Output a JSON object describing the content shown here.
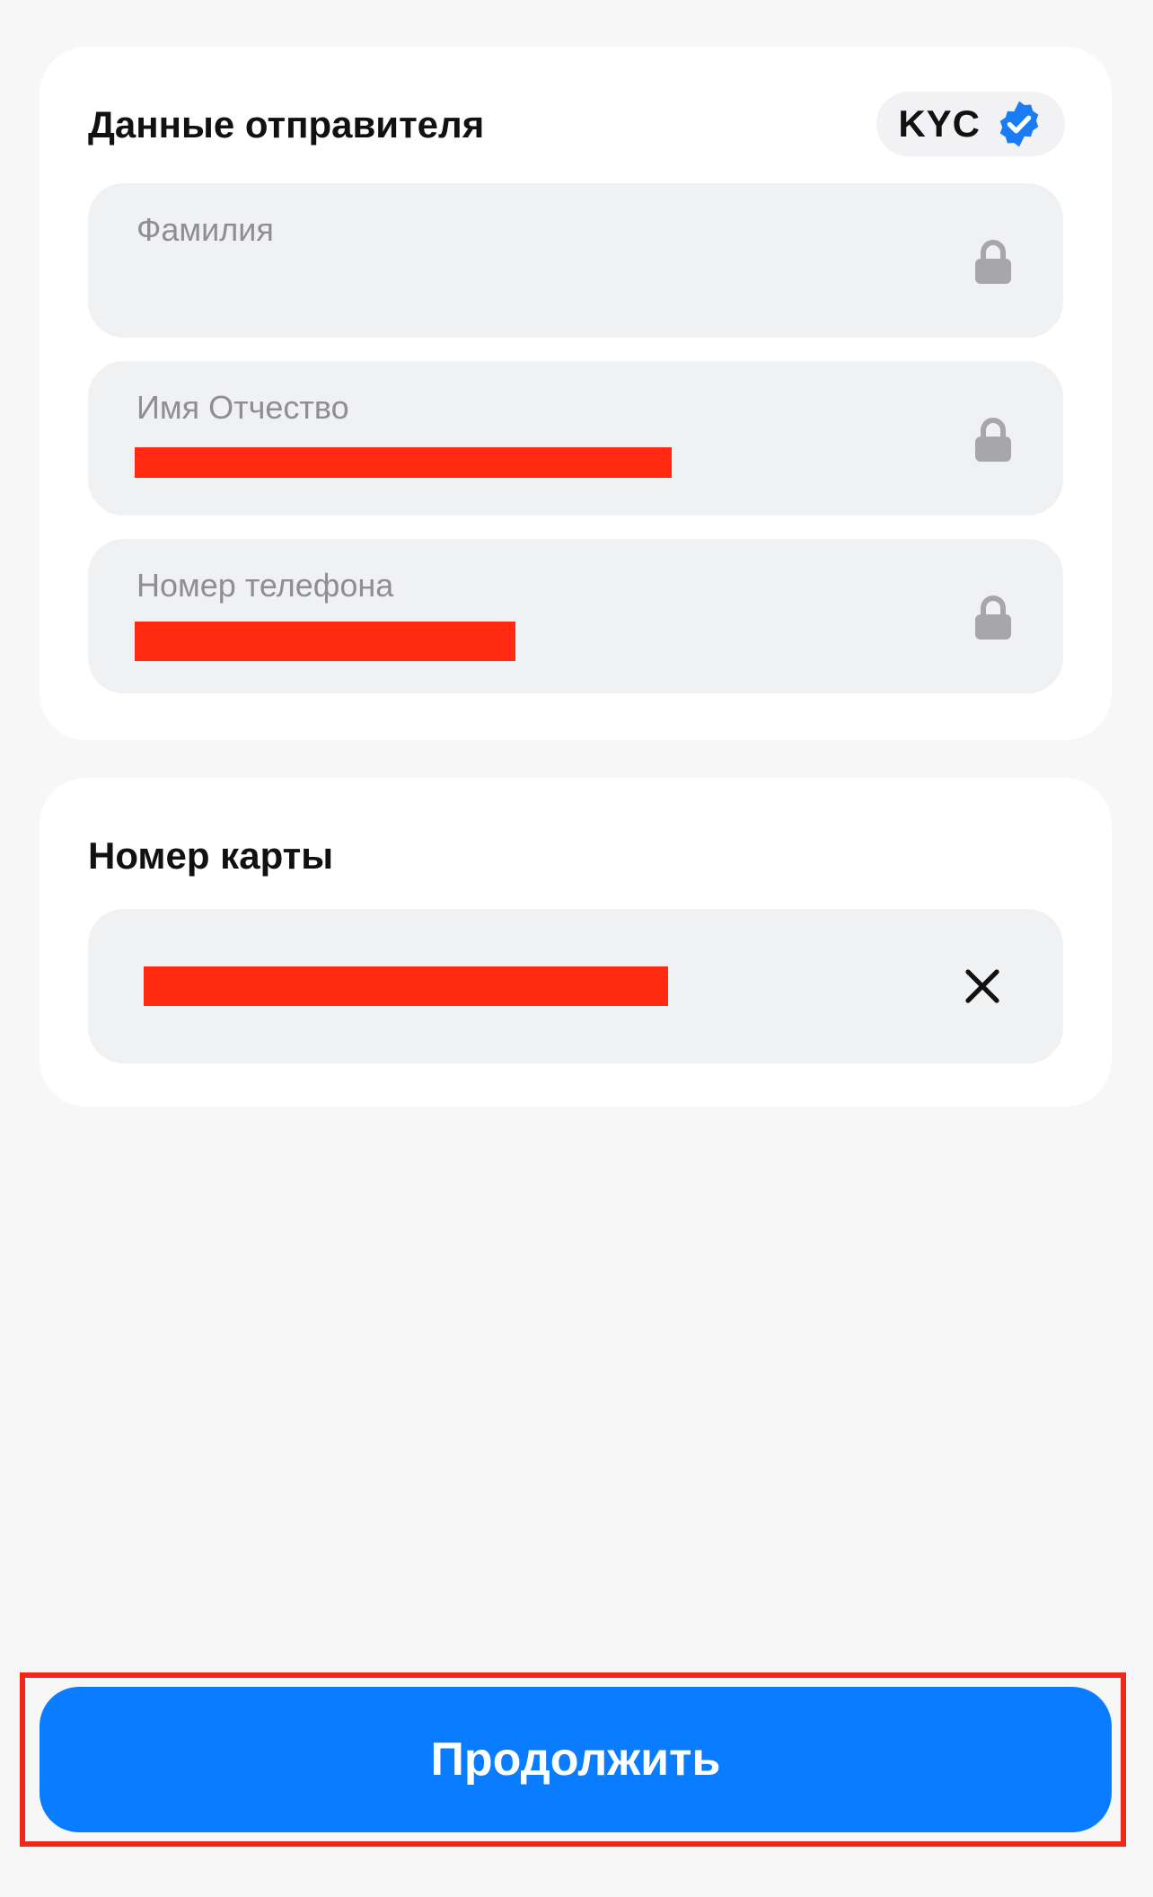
{
  "sender_section": {
    "title": "Данные отправителя",
    "kyc_badge": {
      "label": "KYC",
      "icon": "verified-badge-icon",
      "icon_color": "#1a7cf5"
    },
    "fields": [
      {
        "label": "Фамилия",
        "value": "",
        "redacted": true,
        "icon": "lock-icon"
      },
      {
        "label": "Имя Отчество",
        "value": "",
        "redacted": true,
        "icon": "lock-icon"
      },
      {
        "label": "Номер телефона",
        "value": "",
        "redacted": true,
        "icon": "lock-icon"
      }
    ]
  },
  "card_section": {
    "title": "Номер карты",
    "field": {
      "value": "",
      "redacted": true,
      "icon": "close-icon"
    }
  },
  "continue_button": {
    "label": "Продолжить",
    "color": "#0a7cff"
  },
  "colors": {
    "background": "#f7f7f8",
    "card": "#ffffff",
    "field": "#f0f1f3",
    "redaction": "#ff2a10",
    "highlight_outline": "#f2271c"
  }
}
